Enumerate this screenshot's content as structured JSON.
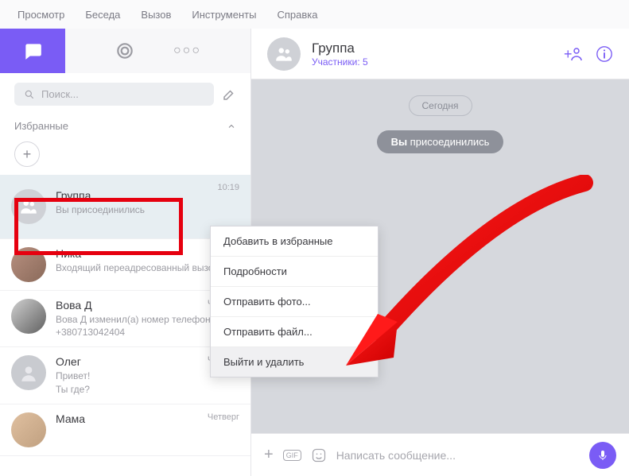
{
  "menu": [
    "Просмотр",
    "Беседа",
    "Вызов",
    "Инструменты",
    "Справка"
  ],
  "search": {
    "placeholder": "Поиск..."
  },
  "favorites": {
    "label": "Избранные"
  },
  "chats": [
    {
      "name": "Группа",
      "msg": "Вы присоединились",
      "time": "10:19",
      "selected": true,
      "type": "group"
    },
    {
      "name": "Ника",
      "msg": "Входящий переадресованный вызов",
      "time": "",
      "type": "user"
    },
    {
      "name": "Вова Д",
      "msg": "Вова Д изменил(а) номер телефона на +380713042404",
      "time": "Четверг",
      "type": "user"
    },
    {
      "name": "Олег",
      "msg": "Привет!\nТы где?",
      "time": "Четверг",
      "type": "user"
    },
    {
      "name": "Мама",
      "msg": "",
      "time": "Четверг",
      "type": "user"
    }
  ],
  "header": {
    "title": "Группа",
    "subtitle": "Участники: 5"
  },
  "messages": {
    "date": "Сегодня",
    "system_prefix": "Вы",
    "system_rest": " присоединились"
  },
  "composer": {
    "placeholder": "Написать сообщение..."
  },
  "context_menu": {
    "items": [
      "Добавить в избранные",
      "Подробности",
      "Отправить фото...",
      "Отправить файл...",
      "Выйти и удалить"
    ]
  }
}
